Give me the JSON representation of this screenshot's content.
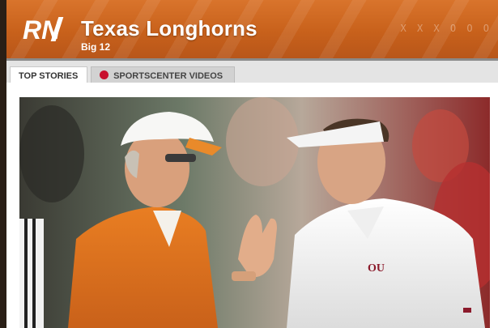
{
  "header": {
    "logo_text": "RN",
    "team_name": "Texas Longhorns",
    "conference": "Big 12",
    "decoration": "X X X O O O"
  },
  "tabs": [
    {
      "label": "Top Stories",
      "active": true
    },
    {
      "label": "SportsCenter Videos",
      "active": false,
      "icon": "sportscenter-logo-icon"
    }
  ],
  "colors": {
    "header_orange": "#d9742c",
    "tab_active_bg": "#ffffff",
    "tab_inactive_bg": "#d2d2d2",
    "texas_orange": "#e07a1f",
    "oklahoma_crimson": "#8b1a2b"
  },
  "photo": {
    "icon": "story-photo-image"
  }
}
